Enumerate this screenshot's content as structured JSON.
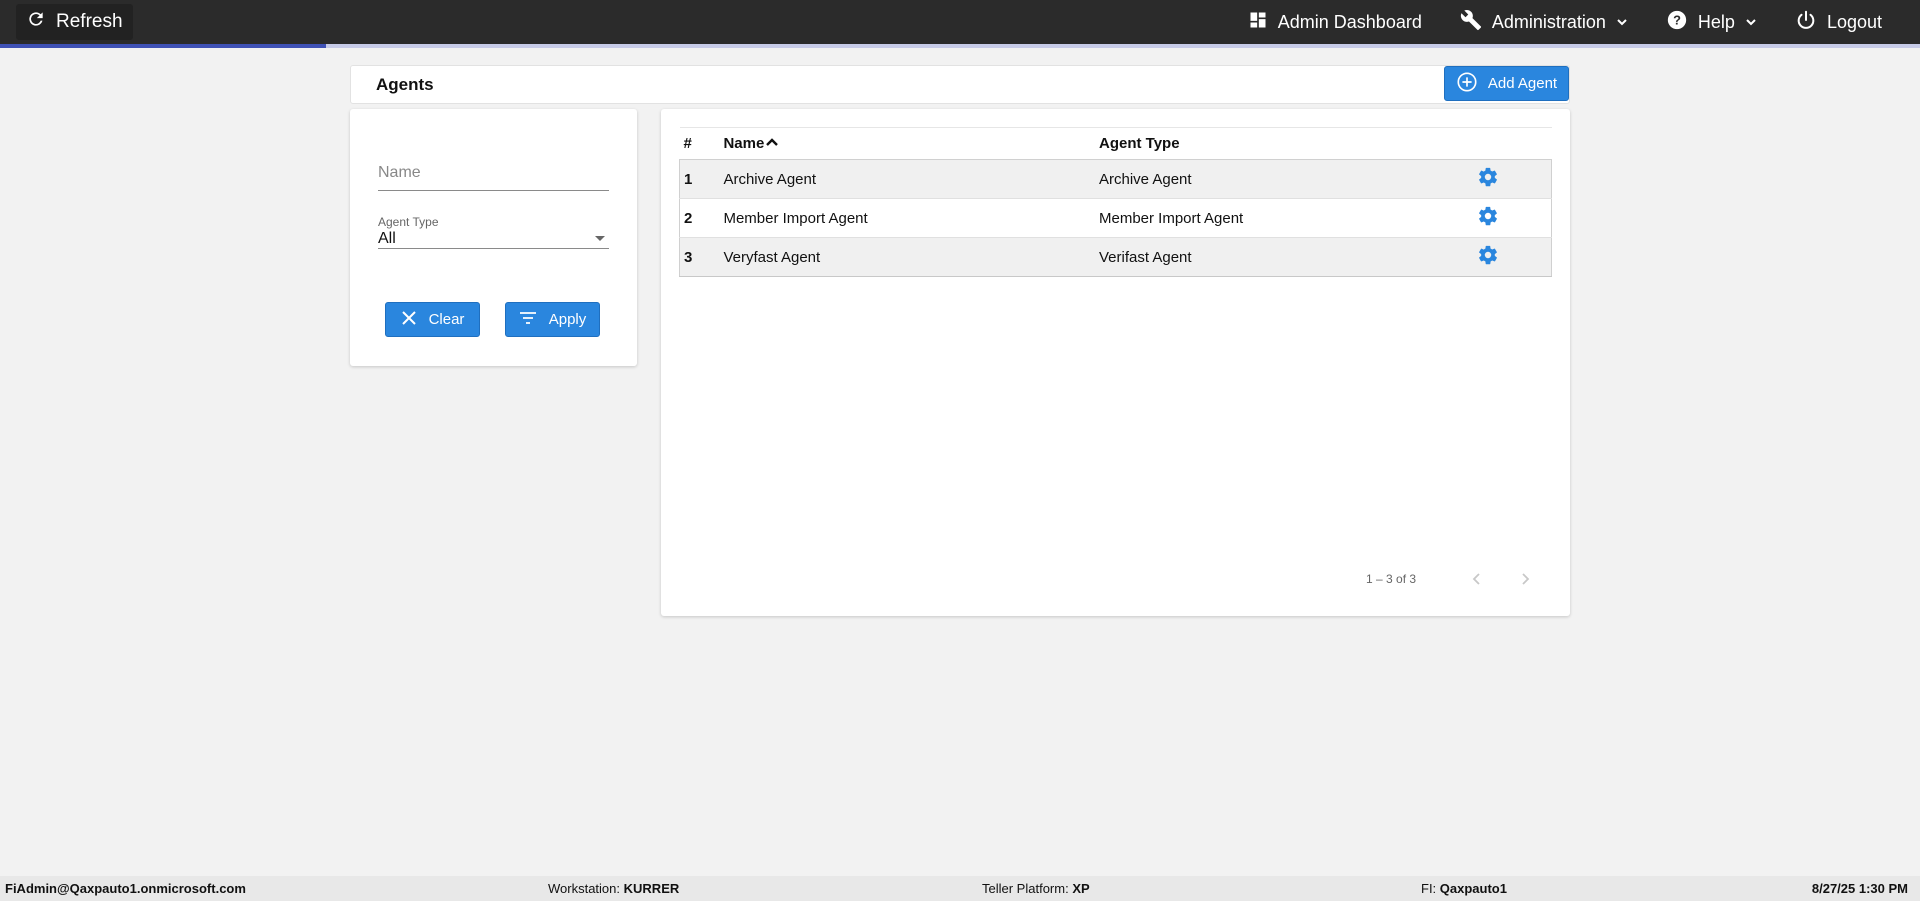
{
  "topbar": {
    "refresh_label": "Refresh",
    "admin_dashboard_label": "Admin Dashboard",
    "administration_label": "Administration",
    "help_label": "Help",
    "logout_label": "Logout",
    "loading_progress": 0.17
  },
  "page": {
    "title": "Agents",
    "add_agent_label": "Add Agent"
  },
  "filters": {
    "name_placeholder": "Name",
    "name_value": "",
    "agent_type_label": "Agent Type",
    "agent_type_value": "All",
    "clear_label": "Clear",
    "apply_label": "Apply"
  },
  "table": {
    "headers": {
      "num": "#",
      "name": "Name",
      "agent_type": "Agent Type"
    },
    "rows": [
      {
        "num": "1",
        "name": "Archive Agent",
        "agent_type": "Archive Agent"
      },
      {
        "num": "2",
        "name": "Member Import Agent",
        "agent_type": "Member Import Agent"
      },
      {
        "num": "3",
        "name": "Veryfast Agent",
        "agent_type": "Verifast Agent"
      }
    ],
    "pager_text": "1 – 3 of 3"
  },
  "statusbar": {
    "user": "FiAdmin@Qaxpauto1.onmicrosoft.com",
    "workstation_label": "Workstation:",
    "workstation_value": "KURRER",
    "platform_label": "Teller Platform:",
    "platform_value": "XP",
    "fi_label": "FI:",
    "fi_value": "Qaxpauto1",
    "datetime": "8/27/25 1:30 PM"
  },
  "colors": {
    "accent": "#2a86de",
    "topbar": "#2b2b2b",
    "progress": "#3f51b5"
  },
  "icons": [
    "refresh-icon",
    "dashboard-icon",
    "wrench-icon",
    "help-icon",
    "chevron-down-icon",
    "power-icon",
    "add-circle-icon",
    "close-icon",
    "filter-icon",
    "sort-up-icon",
    "gear-icon",
    "chevron-left-icon",
    "chevron-right-icon"
  ]
}
